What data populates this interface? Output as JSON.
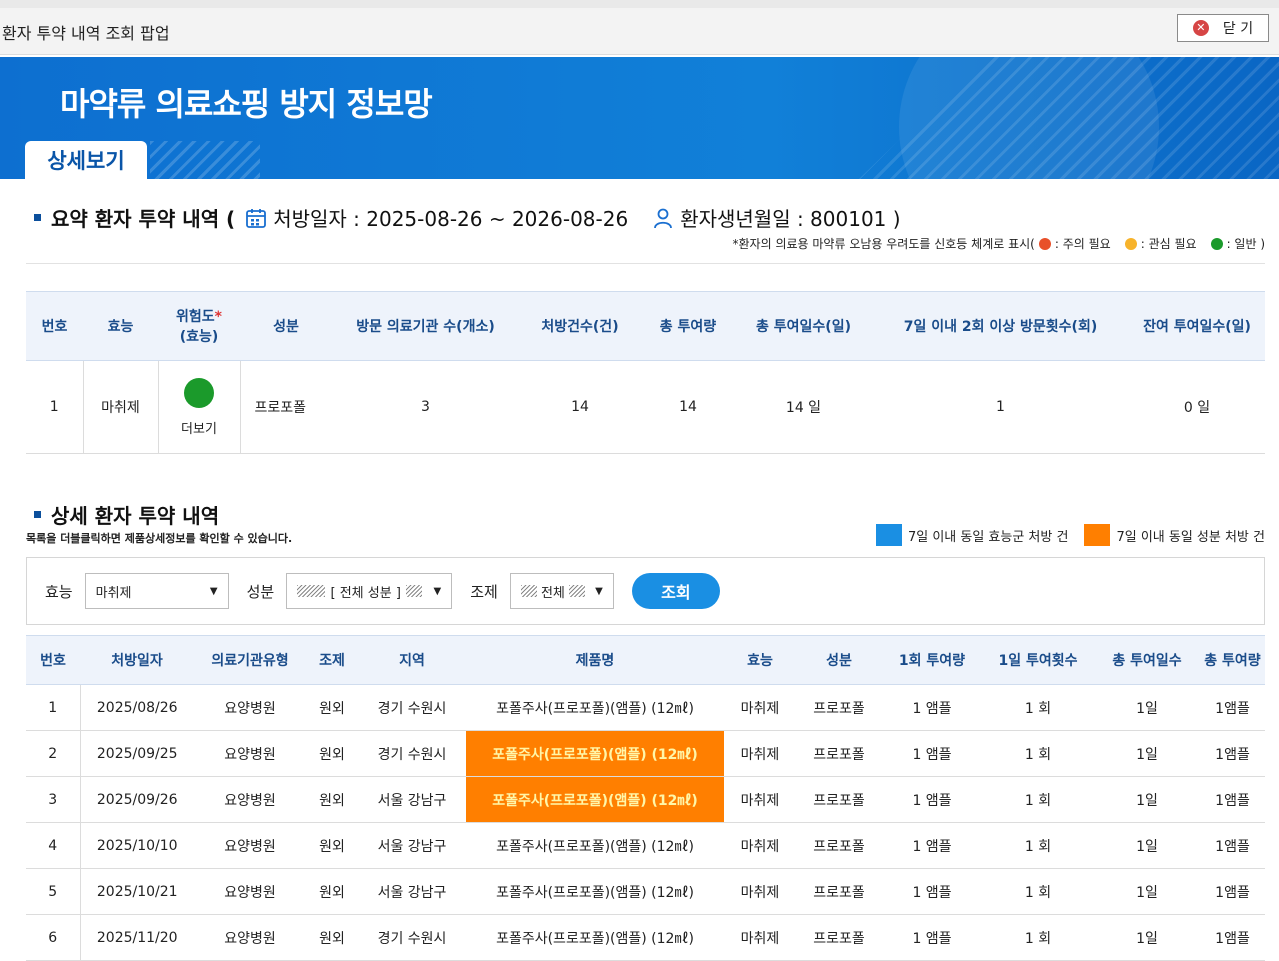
{
  "window": {
    "title": "환자 투약 내역 조회 팝업",
    "close_label": "닫 기"
  },
  "banner": {
    "brand": "마약류 의료쇼핑 방지 정보망",
    "tab": "상세보기"
  },
  "summary": {
    "heading": "요약 환자 투약 내역 (",
    "prescription_period_label": "처방일자 : 2025-08-26 ~ 2026-08-26",
    "birth_label": "환자생년월일 : 800101 )",
    "legend_prefix": "*환자의 의료용 마약류 오남용 우려도를 신호등 체계로 표시(",
    "legend": [
      {
        "label": ": 주의 필요",
        "color": "#e8502a"
      },
      {
        "label": ": 관심 필요",
        "color": "#f7b32b"
      },
      {
        "label": ": 일반 )",
        "color": "#1b9a2b"
      }
    ],
    "columns": [
      "번호",
      "효능",
      "위험도*\n(효능)",
      "성분",
      "방문 의료기관 수(개소)",
      "처방건수(건)",
      "총 투여량",
      "총 투여일수(일)",
      "7일 이내 2회 이상 방문횟수(회)",
      "잔여 투여일수(일)"
    ],
    "row": {
      "no": "1",
      "efficacy": "마취제",
      "risk_color": "#1b9a2b",
      "risk_more": "더보기",
      "ingredient": "프로포폴",
      "institutions": "3",
      "prescriptions": "14",
      "total_dose": "14",
      "total_days": "14 일",
      "visits_7days": "1",
      "remaining_days": "0 일"
    }
  },
  "detail": {
    "heading": "상세 환자 투약 내역",
    "subtext": "목록을 더블클릭하면 제품상세정보를 확인할 수 있습니다.",
    "legend": [
      {
        "label": "7일 이내 동일 효능군 처방 건",
        "color": "#1a8fe3"
      },
      {
        "label": "7일 이내 동일 성분 처방 건",
        "color": "#ff7f00"
      }
    ],
    "filter": {
      "efficacy_label": "효능",
      "efficacy_value": "마취제",
      "ingredient_label": "성분",
      "ingredient_value": "[ 전체 성분 ]",
      "formulation_label": "조제",
      "formulation_value": "전체",
      "search_label": "조회"
    },
    "columns": [
      "번호",
      "처방일자",
      "의료기관유형",
      "조제",
      "지역",
      "제품명",
      "효능",
      "성분",
      "1회 투여량",
      "1일 투여횟수",
      "총 투여일수",
      "총 투여량"
    ],
    "rows": [
      {
        "no": "1",
        "date": "2025/08/26",
        "inst": "요양병원",
        "prep": "원외",
        "region": "경기 수원시",
        "product": "포폴주사(프로포폴)(앰플) (12㎖)",
        "eff": "마취제",
        "ing": "프로포폴",
        "dose": "1 앰플",
        "freq": "1 회",
        "days": "1일",
        "total": "1앰플",
        "highlight": false
      },
      {
        "no": "2",
        "date": "2025/09/25",
        "inst": "요양병원",
        "prep": "원외",
        "region": "경기 수원시",
        "product": "포폴주사(프로포폴)(앰플) (12㎖)",
        "eff": "마취제",
        "ing": "프로포폴",
        "dose": "1 앰플",
        "freq": "1 회",
        "days": "1일",
        "total": "1앰플",
        "highlight": true
      },
      {
        "no": "3",
        "date": "2025/09/26",
        "inst": "요양병원",
        "prep": "원외",
        "region": "서울 강남구",
        "product": "포폴주사(프로포폴)(앰플) (12㎖)",
        "eff": "마취제",
        "ing": "프로포폴",
        "dose": "1 앰플",
        "freq": "1 회",
        "days": "1일",
        "total": "1앰플",
        "highlight": true
      },
      {
        "no": "4",
        "date": "2025/10/10",
        "inst": "요양병원",
        "prep": "원외",
        "region": "서울 강남구",
        "product": "포폴주사(프로포폴)(앰플) (12㎖)",
        "eff": "마취제",
        "ing": "프로포폴",
        "dose": "1 앰플",
        "freq": "1 회",
        "days": "1일",
        "total": "1앰플",
        "highlight": false
      },
      {
        "no": "5",
        "date": "2025/10/21",
        "inst": "요양병원",
        "prep": "원외",
        "region": "서울 강남구",
        "product": "포폴주사(프로포폴)(앰플) (12㎖)",
        "eff": "마취제",
        "ing": "프로포폴",
        "dose": "1 앰플",
        "freq": "1 회",
        "days": "1일",
        "total": "1앰플",
        "highlight": false
      },
      {
        "no": "6",
        "date": "2025/11/20",
        "inst": "요양병원",
        "prep": "원외",
        "region": "경기 수원시",
        "product": "포폴주사(프로포폴)(앰플) (12㎖)",
        "eff": "마취제",
        "ing": "프로포폴",
        "dose": "1 앰플",
        "freq": "1 회",
        "days": "1일",
        "total": "1앰플",
        "highlight": false
      }
    ]
  }
}
